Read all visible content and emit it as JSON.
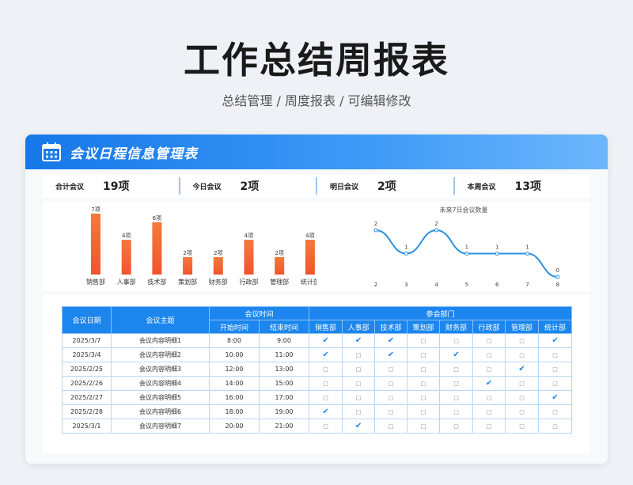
{
  "title": "工作总结周报表",
  "subtitle": "总结管理 / 周度报表 /  可编辑修改",
  "card_title": "会议日程信息管理表",
  "stats": [
    {
      "label": "合计会议",
      "value": "19项"
    },
    {
      "label": "今日会议",
      "value": "2项"
    },
    {
      "label": "明日会议",
      "value": "2项"
    },
    {
      "label": "本周会议",
      "value": "13项"
    }
  ],
  "chart_data": [
    {
      "type": "bar",
      "categories": [
        "销售部",
        "人事部",
        "技术部",
        "策划部",
        "财务部",
        "行政部",
        "管理部",
        "统计部"
      ],
      "values": [
        7,
        4,
        6,
        2,
        2,
        4,
        2,
        4
      ],
      "data_labels": [
        "7项",
        "4项",
        "6项",
        "2项",
        "2项",
        "4项",
        "2项",
        "4项"
      ],
      "colors": {
        "top": "#f47a3c",
        "bottom": "#f2542d"
      }
    },
    {
      "type": "line",
      "title": "未来7日会议数量",
      "x": [
        2,
        3,
        4,
        5,
        6,
        7,
        8
      ],
      "values": [
        2,
        1,
        2,
        1,
        1,
        1,
        0
      ],
      "color": "#2b8fe0"
    }
  ],
  "table": {
    "headers": {
      "date": "会议日期",
      "topic": "会议主题",
      "time_group": "会议时间",
      "start": "开始时间",
      "end": "结束时间",
      "dept_group": "参会部门"
    },
    "departments": [
      "销售部",
      "人事部",
      "技术部",
      "策划部",
      "财务部",
      "行政部",
      "管理部",
      "统计部"
    ],
    "check_mark": "✔",
    "empty_mark": "□",
    "rows": [
      {
        "date": "2025/3/7",
        "topic": "会议内容明细1",
        "start": "8:00",
        "end": "9:00",
        "attend": [
          true,
          true,
          true,
          false,
          false,
          false,
          false,
          true
        ]
      },
      {
        "date": "2025/3/4",
        "topic": "会议内容明细2",
        "start": "10:00",
        "end": "11:00",
        "attend": [
          true,
          false,
          true,
          false,
          true,
          false,
          false,
          false
        ]
      },
      {
        "date": "2025/2/25",
        "topic": "会议内容明细3",
        "start": "12:00",
        "end": "13:00",
        "attend": [
          false,
          false,
          false,
          false,
          false,
          false,
          true,
          false
        ]
      },
      {
        "date": "2025/2/26",
        "topic": "会议内容明细4",
        "start": "14:00",
        "end": "15:00",
        "attend": [
          false,
          false,
          false,
          false,
          false,
          true,
          false,
          false
        ]
      },
      {
        "date": "2025/2/27",
        "topic": "会议内容明细5",
        "start": "16:00",
        "end": "17:00",
        "attend": [
          false,
          false,
          false,
          false,
          false,
          false,
          false,
          true
        ]
      },
      {
        "date": "2025/2/28",
        "topic": "会议内容明细6",
        "start": "18:00",
        "end": "19:00",
        "attend": [
          true,
          false,
          false,
          false,
          false,
          false,
          false,
          false
        ]
      },
      {
        "date": "2025/3/1",
        "topic": "会议内容明细7",
        "start": "20:00",
        "end": "21:00",
        "attend": [
          false,
          true,
          false,
          false,
          false,
          false,
          false,
          false
        ]
      }
    ]
  },
  "icons": {
    "header": "calendar-icon"
  }
}
